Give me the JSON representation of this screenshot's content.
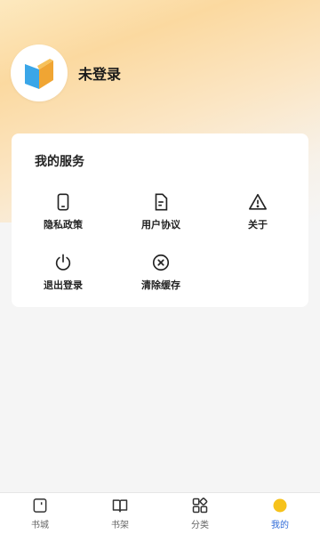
{
  "profile": {
    "login_status": "未登录"
  },
  "services": {
    "title": "我的服务",
    "items": [
      {
        "label": "隐私政策",
        "icon": "phone-icon"
      },
      {
        "label": "用户协议",
        "icon": "document-icon"
      },
      {
        "label": "关于",
        "icon": "warning-icon"
      },
      {
        "label": "退出登录",
        "icon": "power-icon"
      },
      {
        "label": "清除缓存",
        "icon": "clear-icon"
      }
    ]
  },
  "tabbar": {
    "items": [
      {
        "label": "书城",
        "icon": "bookstore-icon",
        "active": false
      },
      {
        "label": "书架",
        "icon": "book-icon",
        "active": false
      },
      {
        "label": "分类",
        "icon": "category-icon",
        "active": false
      },
      {
        "label": "我的",
        "icon": "profile-circle-icon",
        "active": true
      }
    ]
  },
  "colors": {
    "accent": "#2f6bd8",
    "active_icon": "#f6c21b",
    "header_gradient": "#fbd9a0"
  }
}
